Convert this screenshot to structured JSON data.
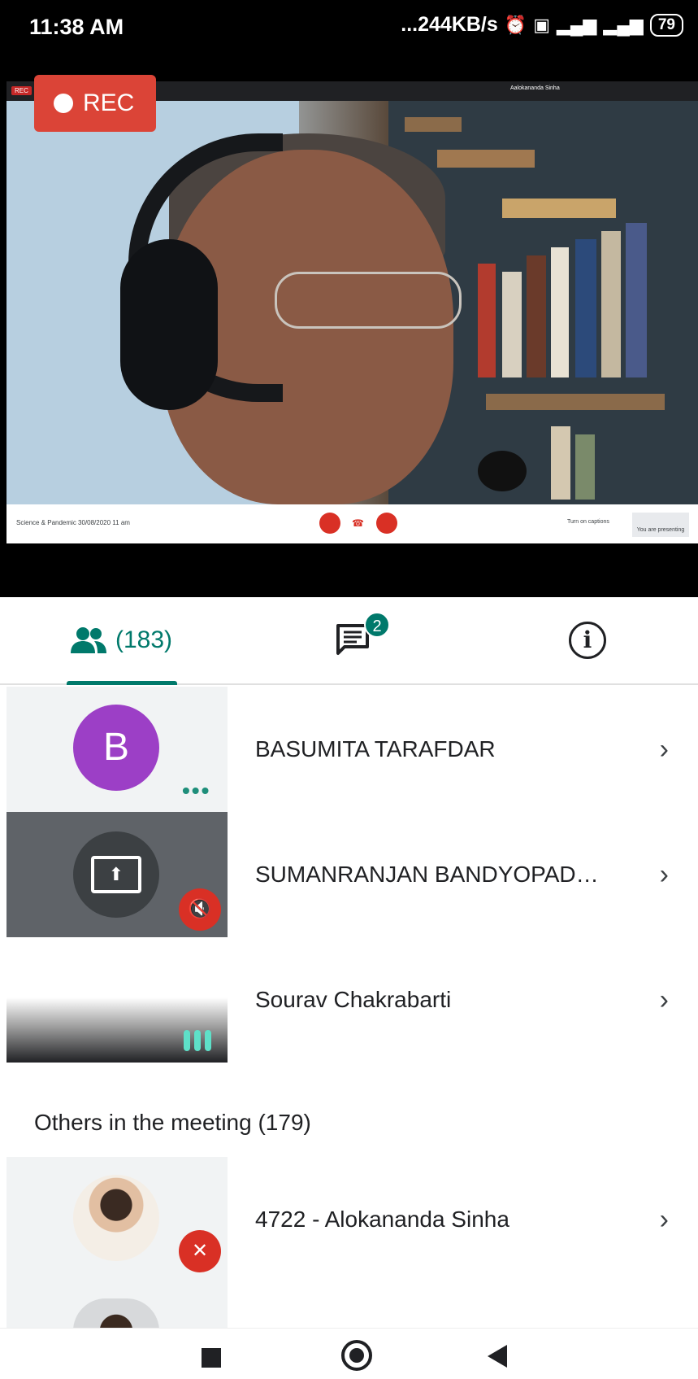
{
  "status_bar": {
    "time": "11:38 AM",
    "network_speed": "...244KB/s",
    "network_type": "4G",
    "battery": "79",
    "icons": [
      "alarm-icon",
      "volte-icon",
      "signal-icon",
      "signal-icon"
    ]
  },
  "video": {
    "rec_label": "REC",
    "mini_rec_label": "REC",
    "presenter_chip": "Aalokananda Sinha",
    "meeting_title": "Science & Pandemic 30/08/2020 11 am",
    "turn_on_captions": "Turn on captions",
    "you_are_presenting": "You are presenting"
  },
  "tabs": {
    "people_count": "(183)",
    "chat_badge": "2",
    "info_symbol": "i"
  },
  "participants": [
    {
      "name": "BASUMITA TARAFDAR",
      "avatar_letter": "B",
      "avatar_color": "#9c3fc6"
    },
    {
      "name": "SUMANRANJAN BANDYOPAD…",
      "presenting": true,
      "muted": true
    },
    {
      "name": "Sourav Chakrabarti",
      "speaking": true
    }
  ],
  "others_heading": "Others in the meeting (179)",
  "others": [
    {
      "name": "4722 - Alokananda Sinha",
      "muted": true
    }
  ],
  "colors": {
    "accent": "#00796b",
    "rec_red": "#db4437",
    "muted_red": "#d93025"
  }
}
